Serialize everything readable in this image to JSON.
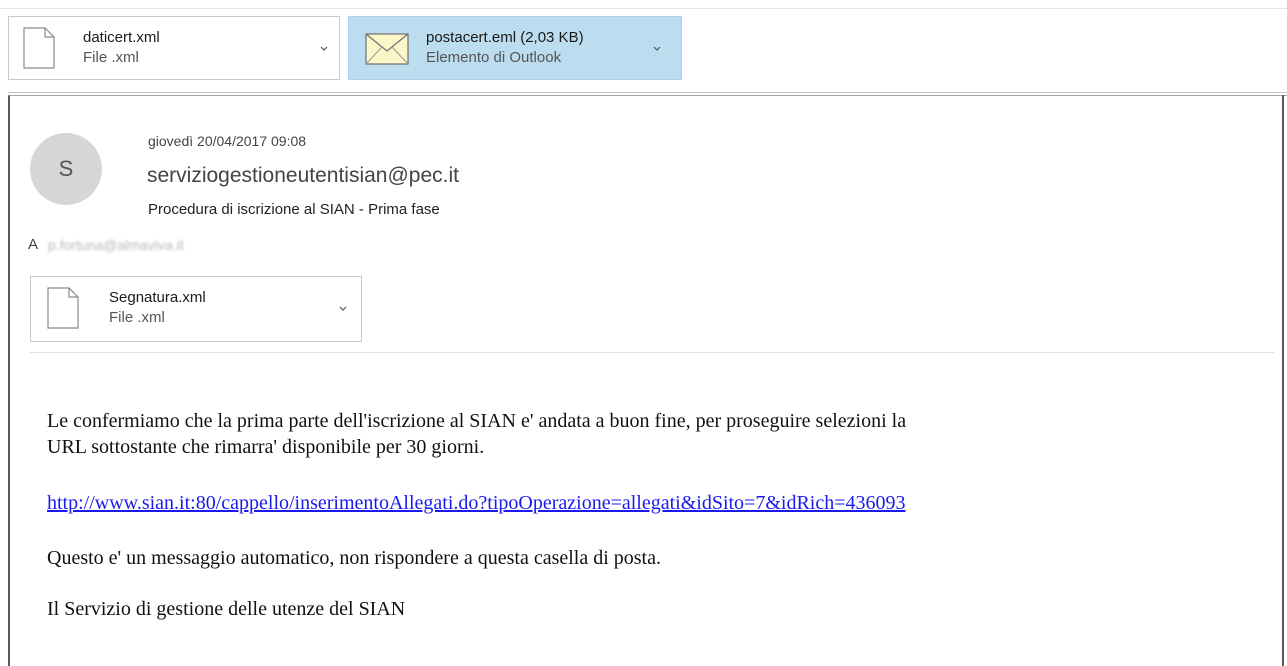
{
  "attachments_top": [
    {
      "name": "daticert.xml",
      "type": "File .xml",
      "icon": "document-icon",
      "selected": false
    },
    {
      "name": "postacert.eml (2,03 KB)",
      "type": "Elemento di Outlook",
      "icon": "envelope-icon",
      "selected": true
    }
  ],
  "message": {
    "avatar_initial": "S",
    "date": "giovedì 20/04/2017 09:08",
    "sender": "serviziogestioneutentisian@pec.it",
    "subject": "Procedura di iscrizione al SIAN - Prima fase",
    "to_label": "A",
    "to_value": "p.fortuna@almaviva.it",
    "attachment": {
      "name": "Segnatura.xml",
      "type": "File .xml",
      "icon": "document-icon"
    }
  },
  "body": {
    "paragraph1_line1": "Le confermiamo che la prima parte dell'iscrizione al SIAN e' andata a buon fine, per proseguire selezioni la",
    "paragraph1_line2": "URL sottostante che rimarra' disponibile per 30 giorni.",
    "link": "http://www.sian.it:80/cappello/inserimentoAllegati.do?tipoOperazione=allegati&idSito=7&idRich=436093",
    "paragraph2": "Questo e' un messaggio automatico, non rispondere a questa casella di posta.",
    "signature": "Il Servizio di gestione delle utenze del SIAN"
  },
  "colors": {
    "selected_attachment_bg": "#bcdcf0",
    "link": "#1a1aee",
    "avatar_bg": "#d6d6d6"
  }
}
